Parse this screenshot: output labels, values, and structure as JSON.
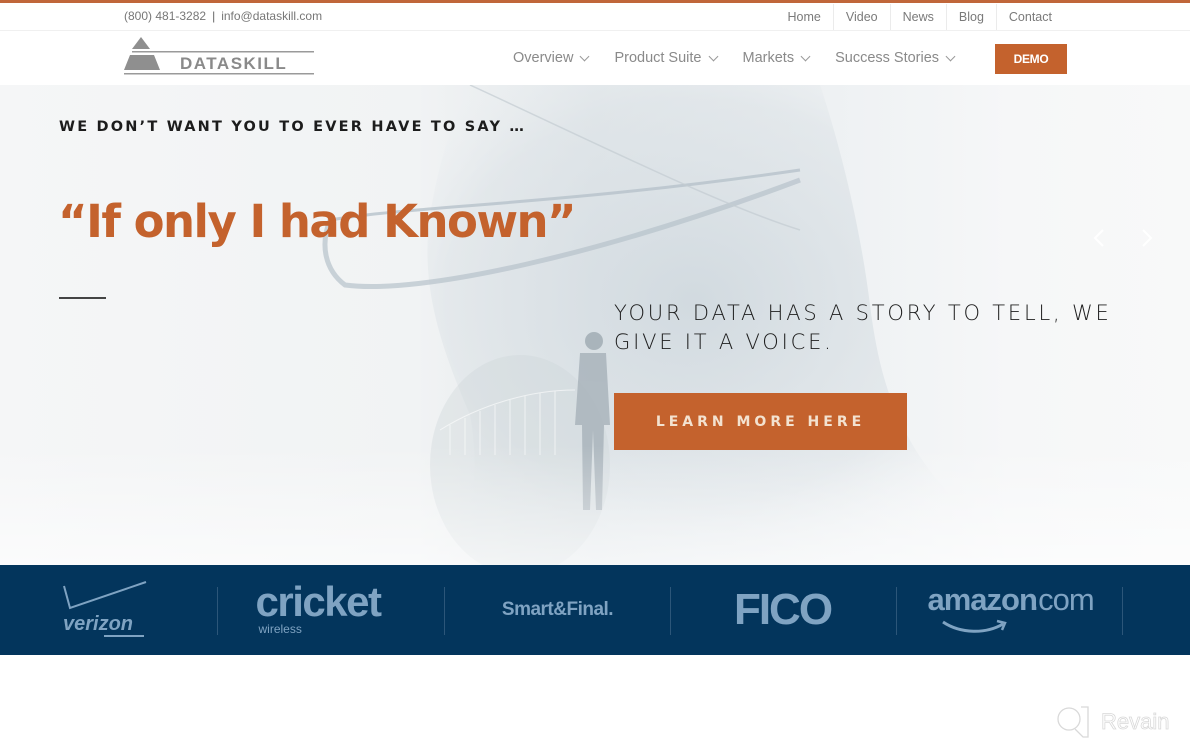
{
  "colors": {
    "accent": "#c4622d",
    "navy_band": "#03355c",
    "logo_tint": "#7fa3c2",
    "nav_text": "#8a8a8a"
  },
  "utility_bar": {
    "phone": "(800) 481-3282",
    "separator": "|",
    "email": "info@dataskill.com",
    "links": [
      "Home",
      "Video",
      "News",
      "Blog",
      "Contact"
    ]
  },
  "header": {
    "logo_text": "DATASKILL",
    "nav": [
      {
        "label": "Overview",
        "icon": "chevron-down-icon"
      },
      {
        "label": "Product Suite",
        "icon": "chevron-down-icon"
      },
      {
        "label": "Markets",
        "icon": "chevron-down-icon"
      },
      {
        "label": "Success Stories",
        "icon": "chevron-down-icon"
      }
    ],
    "demo_label": "DEMO"
  },
  "hero": {
    "eyebrow": "WE DON’T WANT YOU TO EVER HAVE TO SAY …",
    "title": "“If only I had Known”",
    "tagline": "YOUR DATA HAS A STORY TO TELL, WE GIVE IT A VOICE.",
    "cta_label": "LEARN MORE HERE",
    "prev_icon": "chevron-left-icon",
    "next_icon": "chevron-right-icon"
  },
  "client_logos": [
    {
      "name": "verizon",
      "text": "verizon"
    },
    {
      "name": "cricket",
      "text": "cricket",
      "subtext": "wireless"
    },
    {
      "name": "smart-and-final",
      "text": "Smart&Final."
    },
    {
      "name": "fico",
      "text": "FICO"
    },
    {
      "name": "amazon",
      "text": "amazon",
      "suffix": ".com"
    }
  ],
  "watermark": {
    "text": "Revain"
  }
}
